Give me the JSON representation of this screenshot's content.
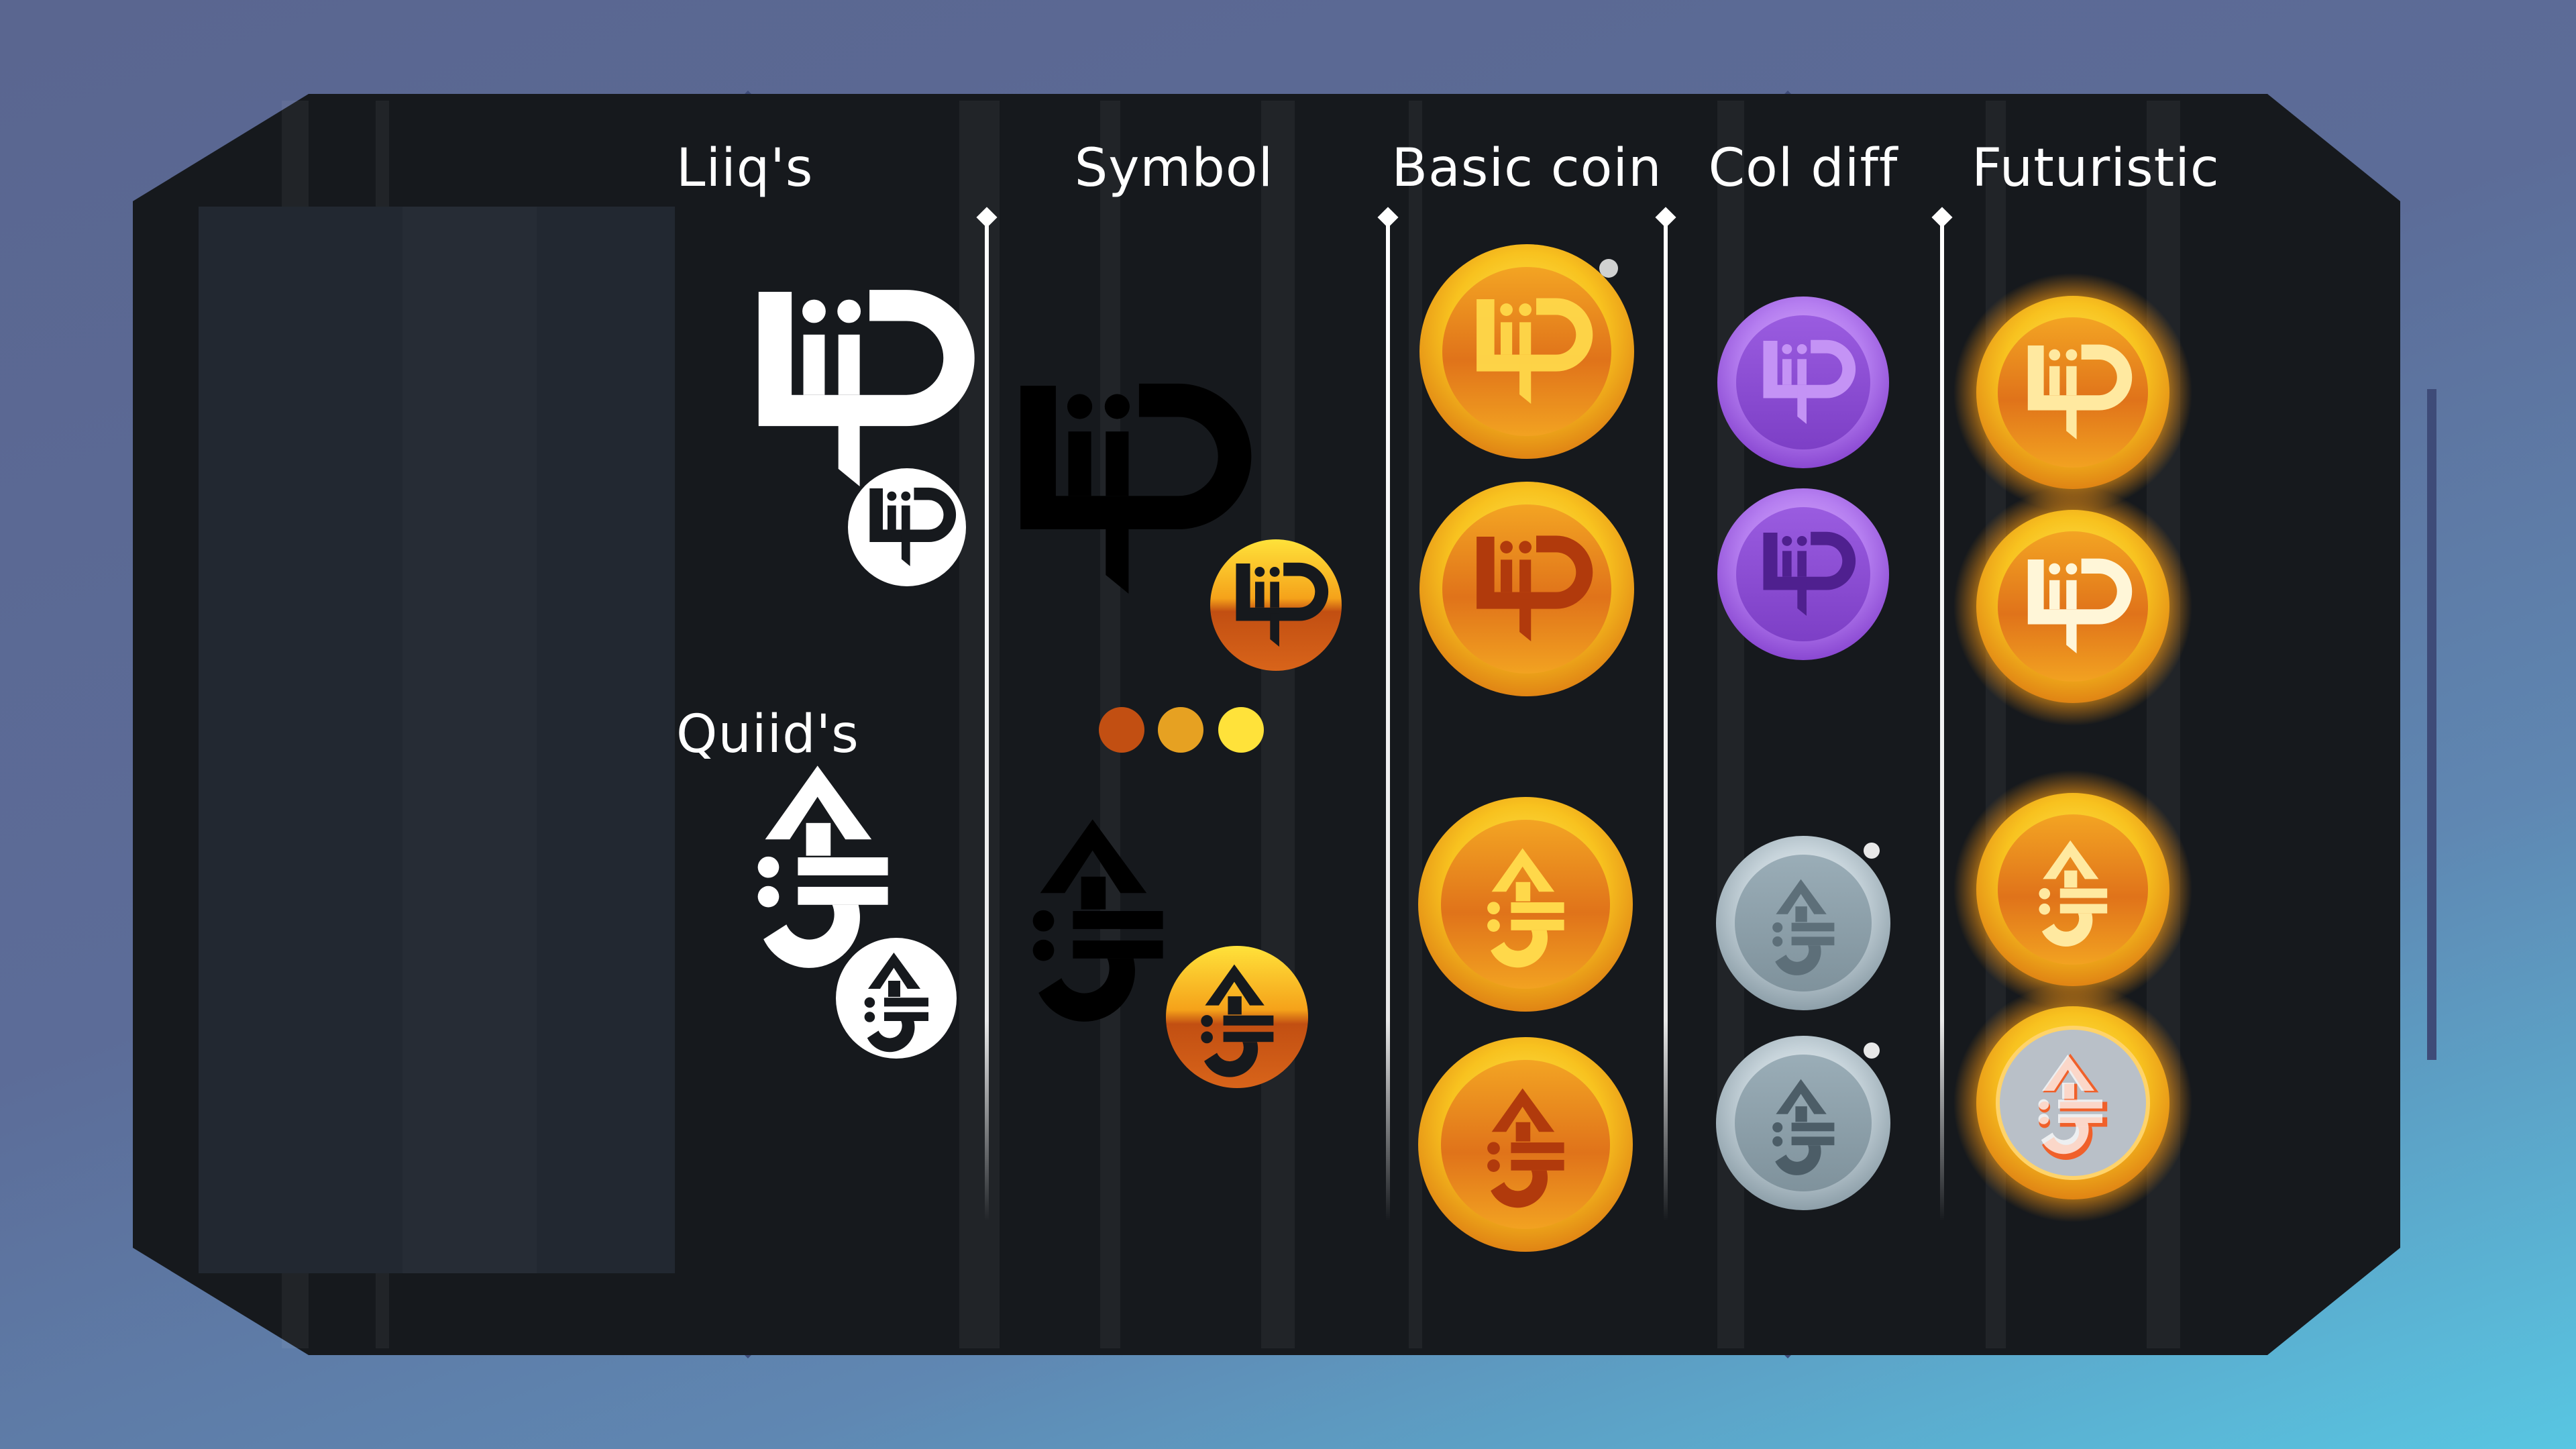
{
  "headers": {
    "liiqs": "Liiq's",
    "symbol": "Symbol",
    "basic_coin": "Basic coin",
    "col_diff": "Col diff",
    "futuristic": "Futuristic"
  },
  "section_labels": {
    "quiids": "Quiid's"
  },
  "colors": {
    "frame": "#16191d",
    "frame_outline": "#3e4b78",
    "panel": "#222831",
    "gold_light": "#ffe23a",
    "gold_mid": "#f5a21a",
    "orange_dark": "#c24f12",
    "purple": "#a868e6",
    "silver": "#a8b9c2",
    "dot_1": "#c24f12",
    "dot_2": "#e6a122",
    "dot_3": "#ffe23a"
  },
  "icons": {
    "liiq_symbol": "liiq-glyph-icon",
    "quiid_symbol": "quiid-glyph-icon"
  }
}
